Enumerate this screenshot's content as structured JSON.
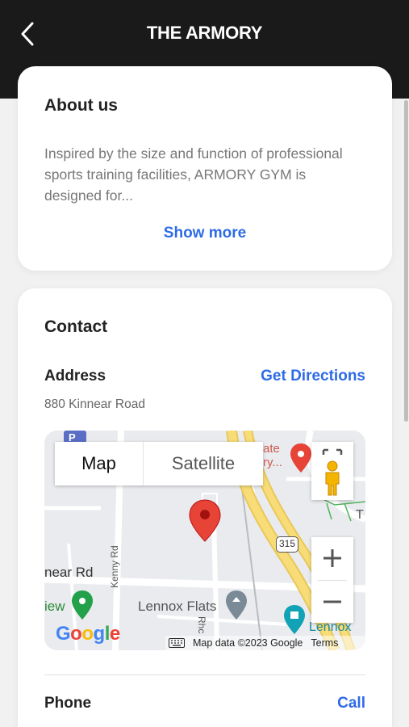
{
  "header": {
    "title": "THE ARMORY",
    "back_icon": "chevron-left-icon"
  },
  "about": {
    "title": "About us",
    "text": "Inspired by the size and function of professional sports training facilities, ARMORY GYM is designed for...",
    "show_more": "Show more"
  },
  "contact": {
    "title": "Contact",
    "address_label": "Address",
    "directions_label": "Get Directions",
    "address": "880 Kinnear Road",
    "phone_label": "Phone",
    "call_label": "Call"
  },
  "map": {
    "type_map": "Map",
    "type_satellite": "Satellite",
    "zoom_in": "+",
    "zoom_out": "−",
    "attribution": "Map data ©2023 Google",
    "terms": "Terms",
    "google": [
      "G",
      "o",
      "o",
      "g",
      "l",
      "e"
    ],
    "labels": {
      "ate": "ate\nry...",
      "near_rd": "near Rd",
      "view": "iew",
      "lennox_flats": "Lennox Flats",
      "lennox": "Lennox",
      "route": "315",
      "kenny_rd": "Kenny Rd",
      "rhc": "Rhc",
      "t": "T",
      "p": "P"
    },
    "colors": {
      "pin": "#e74337",
      "highway": "#f2d56b",
      "link": "#2e6be6"
    }
  }
}
